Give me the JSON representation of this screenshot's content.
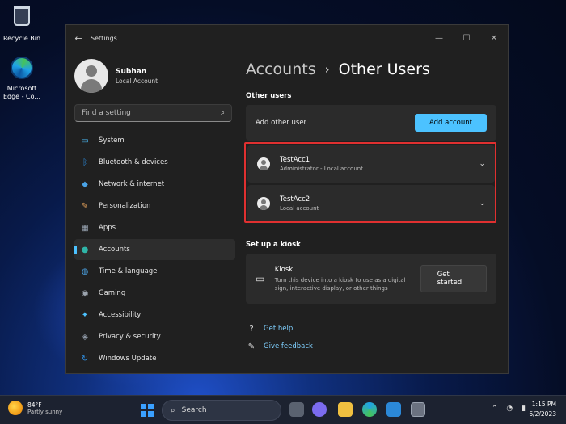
{
  "desktop": {
    "recycle_bin": "Recycle Bin",
    "edge": "Microsoft Edge - Co..."
  },
  "window": {
    "title": "Settings",
    "controls": [
      "minimize-icon",
      "maximize-icon",
      "close-icon"
    ]
  },
  "profile": {
    "name": "Subhan",
    "type": "Local Account"
  },
  "search": {
    "placeholder": "Find a setting"
  },
  "nav": {
    "items": [
      {
        "label": "System",
        "icon": "system-icon",
        "color": "#4cc2ff"
      },
      {
        "label": "Bluetooth & devices",
        "icon": "bluetooth-icon",
        "color": "#2b88d8"
      },
      {
        "label": "Network & internet",
        "icon": "network-icon",
        "color": "#4aa3e6"
      },
      {
        "label": "Personalization",
        "icon": "brush-icon",
        "color": "#e8a45c"
      },
      {
        "label": "Apps",
        "icon": "apps-icon",
        "color": "#9aa6b4"
      },
      {
        "label": "Accounts",
        "icon": "accounts-icon",
        "color": "#2fb5a8",
        "active": true
      },
      {
        "label": "Time & language",
        "icon": "globe-icon",
        "color": "#4ba4e6"
      },
      {
        "label": "Gaming",
        "icon": "gamepad-icon",
        "color": "#9ba3ad"
      },
      {
        "label": "Accessibility",
        "icon": "accessibility-icon",
        "color": "#4cc2ff"
      },
      {
        "label": "Privacy & security",
        "icon": "shield-icon",
        "color": "#8c96a3"
      },
      {
        "label": "Windows Update",
        "icon": "update-icon",
        "color": "#2f8ee0"
      }
    ]
  },
  "breadcrumb": {
    "parent": "Accounts",
    "separator": "›",
    "current": "Other Users"
  },
  "other_users": {
    "section_title": "Other users",
    "add_label": "Add other user",
    "add_button": "Add account",
    "users": [
      {
        "name": "TestAcc1",
        "desc": "Administrator - Local account"
      },
      {
        "name": "TestAcc2",
        "desc": "Local account"
      }
    ]
  },
  "kiosk": {
    "section_title": "Set up a kiosk",
    "title": "Kiosk",
    "desc": "Turn this device into a kiosk to use as a digital sign, interactive display, or other things",
    "button": "Get started"
  },
  "links": {
    "help": "Get help",
    "feedback": "Give feedback"
  },
  "taskbar": {
    "temp": "84°F",
    "weather": "Partly sunny",
    "search": "Search",
    "time": "1:15 PM",
    "date": "6/2/2023"
  },
  "colors": {
    "accent": "#4cc2ff",
    "highlight_outline": "#e03030"
  }
}
